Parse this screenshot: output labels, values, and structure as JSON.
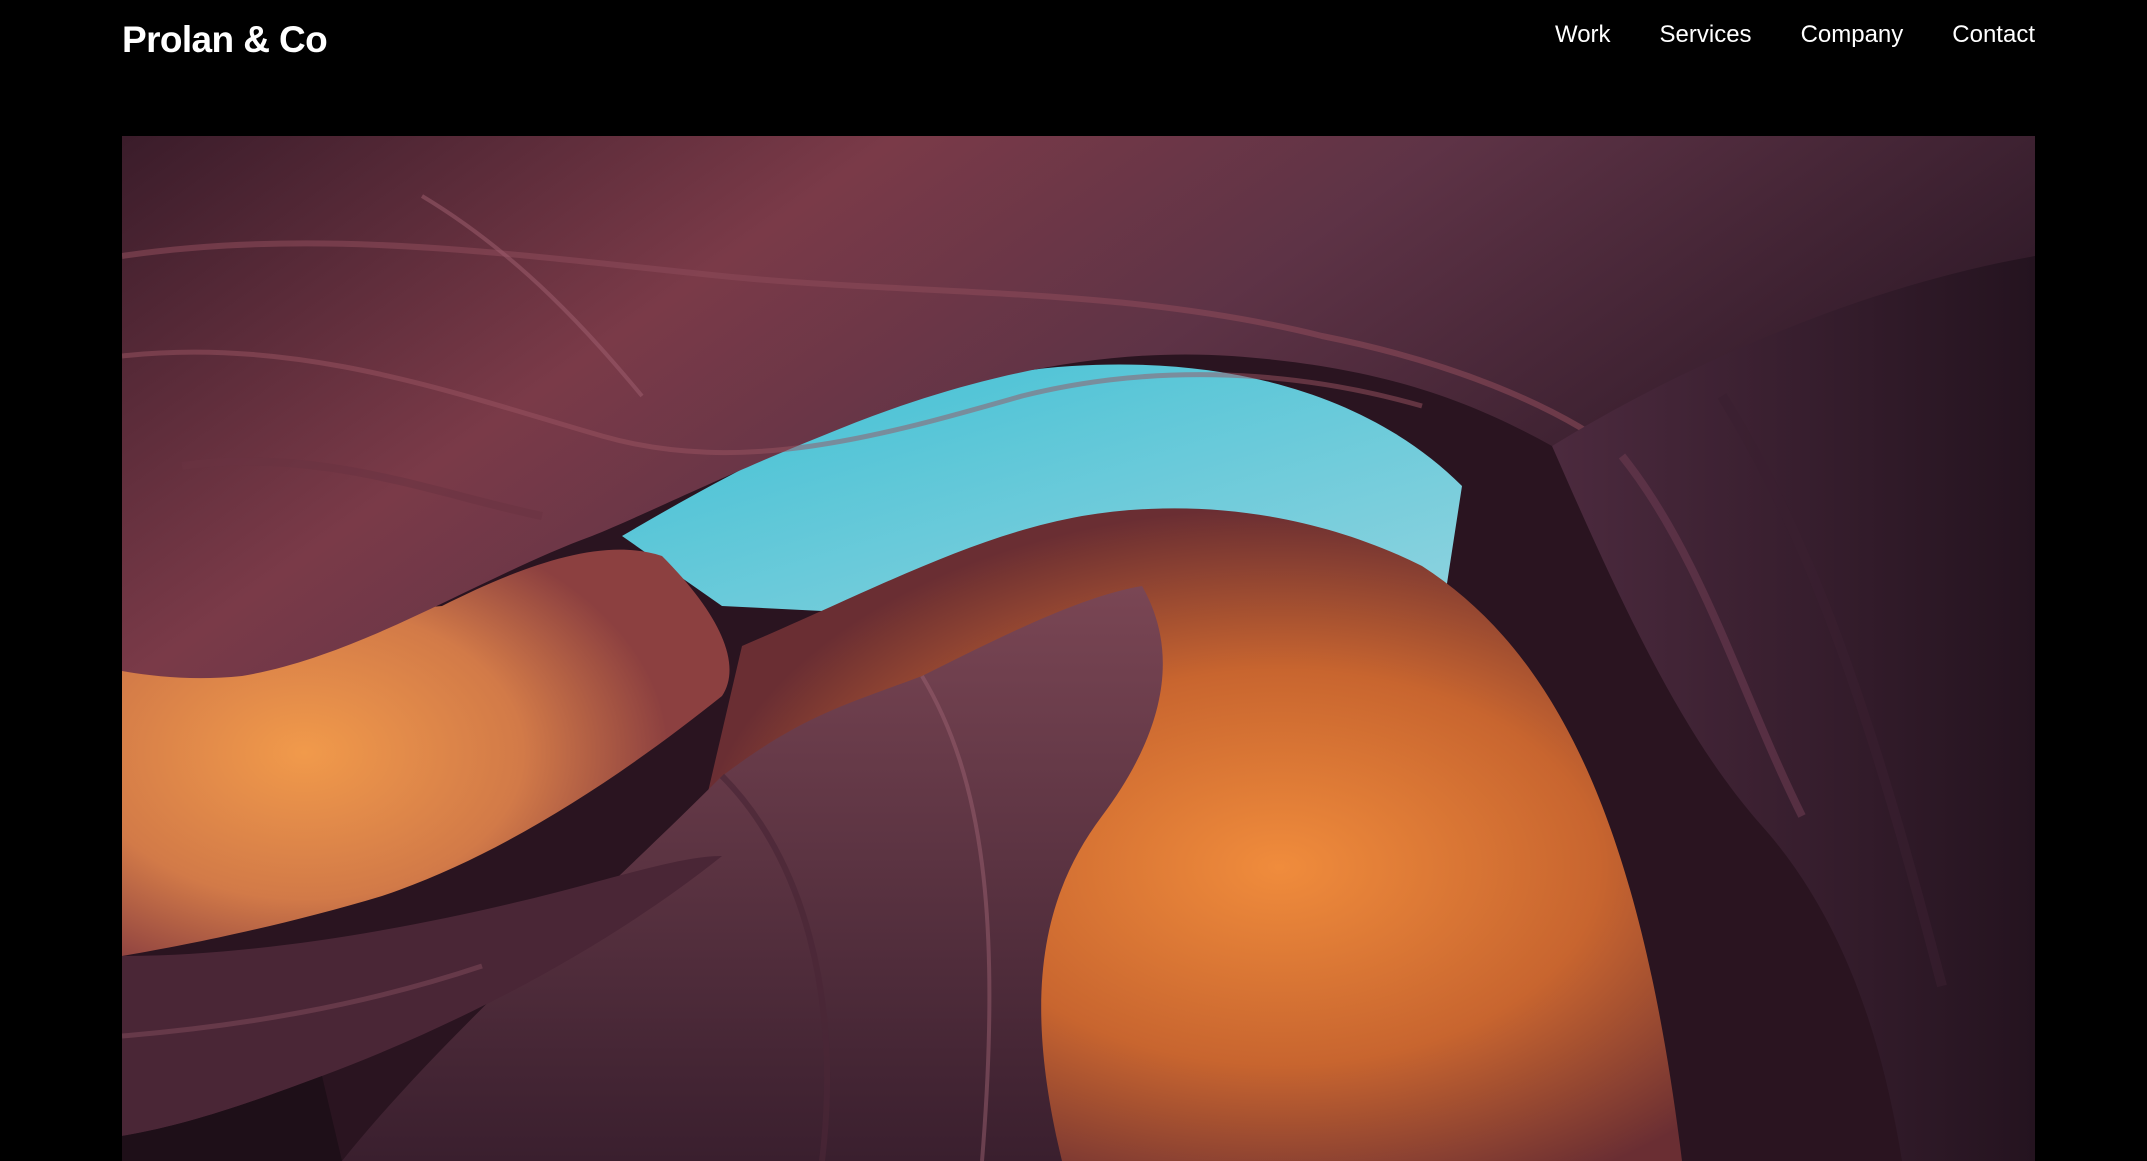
{
  "header": {
    "brand": "Prolan & Co",
    "nav": [
      {
        "label": "Work"
      },
      {
        "label": "Services"
      },
      {
        "label": "Company"
      },
      {
        "label": "Contact"
      }
    ]
  },
  "hero": {
    "subject": "slot-canyon-photo",
    "colors": {
      "sky": "#4cc3d6",
      "rock_orange": "#d9773a",
      "rock_purple": "#5a2f45",
      "rock_dark": "#2b1422"
    }
  }
}
